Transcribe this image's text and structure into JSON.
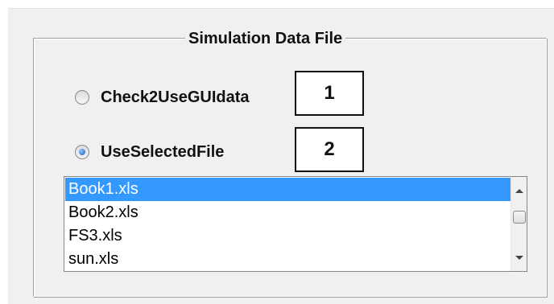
{
  "group": {
    "title": "Simulation Data File"
  },
  "radios": [
    {
      "label": "Check2UseGUIdata",
      "checked": false
    },
    {
      "label": "UseSelectedFile",
      "checked": true
    }
  ],
  "callouts": [
    "1",
    "2"
  ],
  "listbox": {
    "items": [
      "Book1.xls",
      "Book2.xls",
      "FS3.xls",
      "sun.xls"
    ],
    "selected_index": 0
  },
  "colors": {
    "selection": "#3399ff",
    "panel": "#f0f0f0"
  }
}
